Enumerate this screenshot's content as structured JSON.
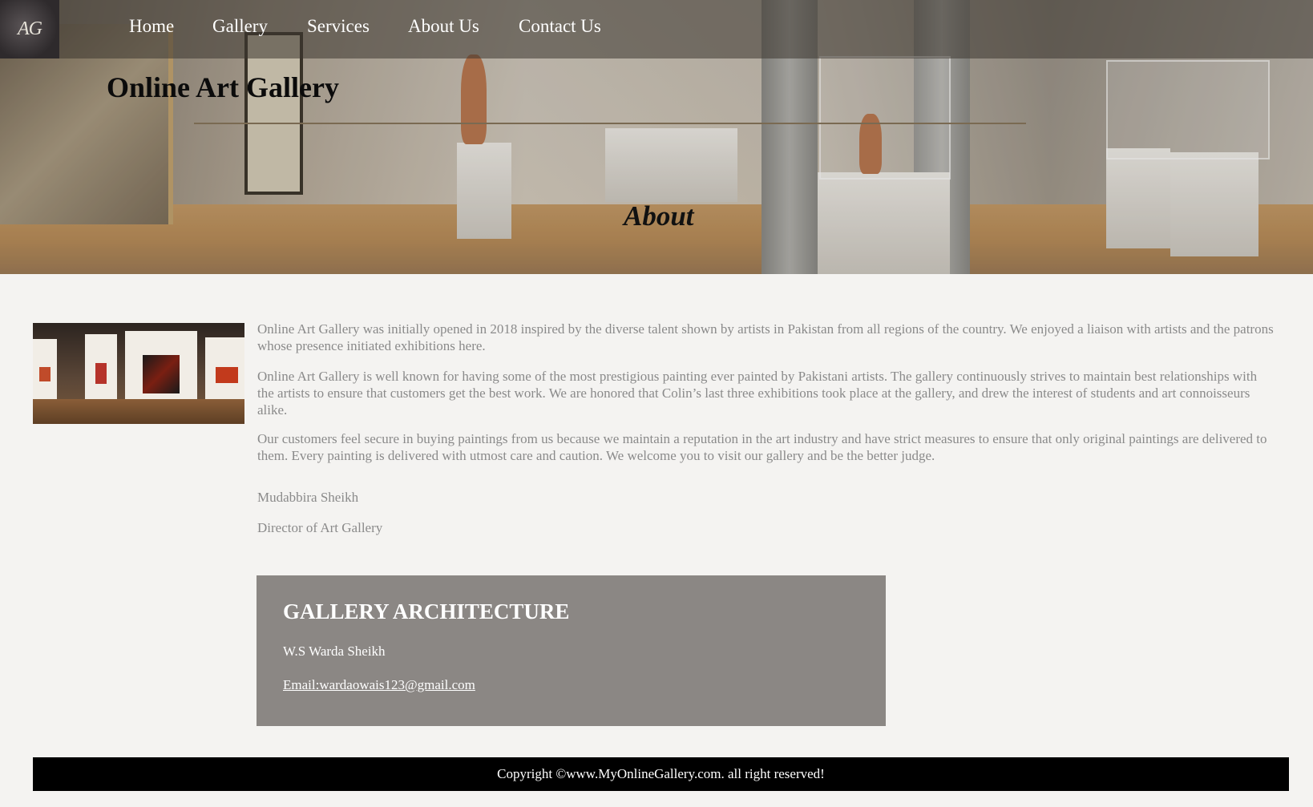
{
  "logo": {
    "text": "AG"
  },
  "nav": {
    "items": [
      {
        "label": "Home"
      },
      {
        "label": "Gallery"
      },
      {
        "label": "Services"
      },
      {
        "label": "About Us"
      },
      {
        "label": "Contact Us"
      }
    ]
  },
  "header": {
    "site_title": "Online Art Gallery",
    "page_heading": "About"
  },
  "about": {
    "paragraphs": [
      "Online Art Gallery was initially opened in 2018 inspired by the diverse talent shown by artists in Pakistan from all regions of the country. We enjoyed a liaison with artists and the patrons whose presence initiated exhibitions here.",
      "Online Art Gallery is well known for having some of the most prestigious painting ever painted by Pakistani artists. The gallery continuously strives to maintain best relationships with the artists to ensure that customers get the best work. We are honored that Colin’s last three exhibitions took place at the gallery, and drew the interest of students and art connoisseurs alike.",
      "Our customers feel secure in buying paintings from us because we maintain a reputation in the art industry and have strict measures to ensure that only original paintings are delivered to them. Every painting is delivered with utmost care and caution. We welcome you to visit our gallery and be the better judge."
    ],
    "signature_name": "Mudabbira Sheikh",
    "signature_title": "Director of Art Gallery"
  },
  "architecture": {
    "title": "GALLERY ARCHITECTURE",
    "name": "W.S Warda Sheikh",
    "email": "Email:wardaowais123@gmail.com"
  },
  "footer": {
    "copyright": "Copyright ©www.MyOnlineGallery.com. all right reserved!"
  }
}
